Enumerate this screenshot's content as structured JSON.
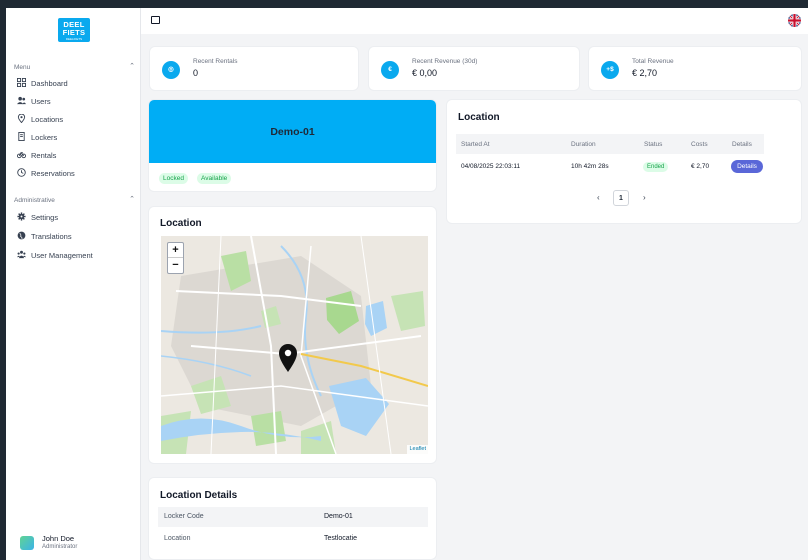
{
  "sidebar": {
    "logo": {
      "line1": "DEEL",
      "line2": "FIETS",
      "tagline": "DEELFIETS"
    },
    "menu_section": "Menu",
    "menu": [
      {
        "label": "Dashboard",
        "icon": "grid-icon"
      },
      {
        "label": "Users",
        "icon": "users-icon"
      },
      {
        "label": "Locations",
        "icon": "map-pin-icon"
      },
      {
        "label": "Lockers",
        "icon": "locker-icon"
      },
      {
        "label": "Rentals",
        "icon": "bike-icon"
      },
      {
        "label": "Reservations",
        "icon": "clock-icon"
      }
    ],
    "admin_section": "Administrative",
    "admin": [
      {
        "label": "Settings",
        "icon": "gear-icon"
      },
      {
        "label": "Translations",
        "icon": "globe-icon"
      },
      {
        "label": "User Management",
        "icon": "user-group-icon"
      }
    ],
    "user": {
      "name": "John Doe",
      "role": "Administrator"
    }
  },
  "stats": [
    {
      "label": "Recent Rentals",
      "value": "0",
      "icon_text": "◎"
    },
    {
      "label": "Recent Revenue (30d)",
      "value": "€ 0,00",
      "icon_text": "€"
    },
    {
      "label": "Total Revenue",
      "value": "€ 2,70",
      "icon_text": "+$"
    }
  ],
  "locker": {
    "name": "Demo-01",
    "badges": [
      "Locked",
      "Available"
    ]
  },
  "map_card": {
    "title": "Location",
    "zoom_in": "+",
    "zoom_out": "−",
    "attribution": "Leaflet"
  },
  "location_table": {
    "title": "Location",
    "headers": [
      "Started At",
      "Duration",
      "Status",
      "Costs",
      "Details"
    ],
    "rows": [
      {
        "started_at": "04/08/2025 22:03:11",
        "duration": "10h 42m 28s",
        "status": "Ended",
        "costs": "€ 2,70",
        "details": "Details"
      }
    ],
    "pagination": {
      "prev": "‹",
      "page": "1",
      "next": "›"
    }
  },
  "location_details": {
    "title": "Location Details",
    "rows": [
      {
        "key": "Locker Code",
        "value": "Demo-01"
      },
      {
        "key": "Location",
        "value": "Testlocatie"
      }
    ]
  },
  "colors": {
    "accent": "#00adf5",
    "button": "#5a67d8",
    "success_bg": "#dcfce7",
    "success_text": "#16a34a"
  }
}
